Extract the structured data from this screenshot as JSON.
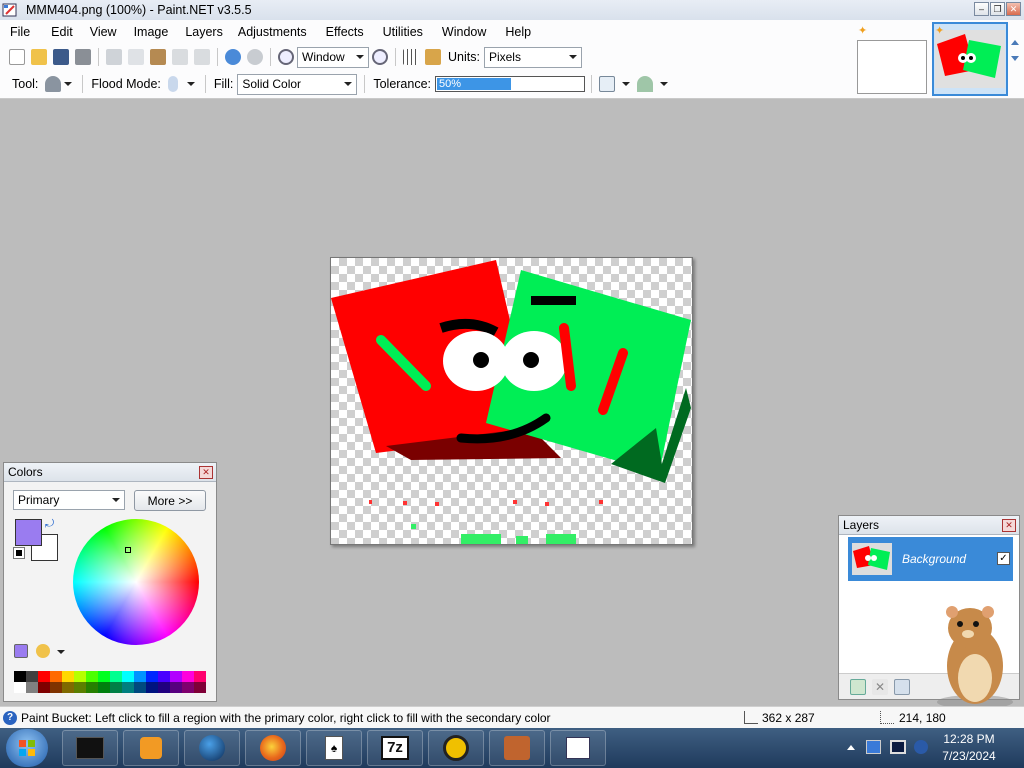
{
  "window": {
    "title": "MMM404.png (100%) - Paint.NET v3.5.5"
  },
  "menu": [
    "File",
    "Edit",
    "View",
    "Image",
    "Layers",
    "Adjustments",
    "Effects",
    "Utilities",
    "Window",
    "Help"
  ],
  "toolbar": {
    "zoom_value": "Window",
    "units_label": "Units:",
    "units_value": "Pixels",
    "tool_label": "Tool:",
    "flood_mode_label": "Flood Mode:",
    "fill_label": "Fill:",
    "fill_value": "Solid Color",
    "tolerance_label": "Tolerance:",
    "tolerance_text": "50%",
    "tolerance_level": 0.5
  },
  "colors_panel": {
    "title": "Colors",
    "mode": "Primary",
    "more_button": "More >>",
    "primary_color": "#9a7cf0",
    "secondary_color": "#ffffff",
    "palette_top": [
      "#000000",
      "#404040",
      "#ff0000",
      "#ff6a00",
      "#ffd800",
      "#b6ff00",
      "#4cff00",
      "#00ff21",
      "#00ff90",
      "#00ffff",
      "#0094ff",
      "#0026ff",
      "#4800ff",
      "#b200ff",
      "#ff00dc",
      "#ff006e"
    ],
    "palette_bottom": [
      "#ffffff",
      "#808080",
      "#7f0000",
      "#7f3300",
      "#7f6a00",
      "#5b7f00",
      "#267f00",
      "#007f0e",
      "#007f46",
      "#007f7f",
      "#004a7f",
      "#00137f",
      "#21007f",
      "#57007f",
      "#7f006e",
      "#7f0037"
    ]
  },
  "layers_panel": {
    "title": "Layers",
    "layer_name": "Background",
    "checked_mark": "✓"
  },
  "status": {
    "hint": "Paint Bucket: Left click to fill a region with the primary color, right click to fill with the secondary color",
    "image_size": "362 x 287",
    "cursor_pos": "214, 180"
  },
  "clock": {
    "time": "12:28 PM",
    "date": "7/23/2024"
  },
  "taskbar": {
    "7z_label": "7z"
  }
}
